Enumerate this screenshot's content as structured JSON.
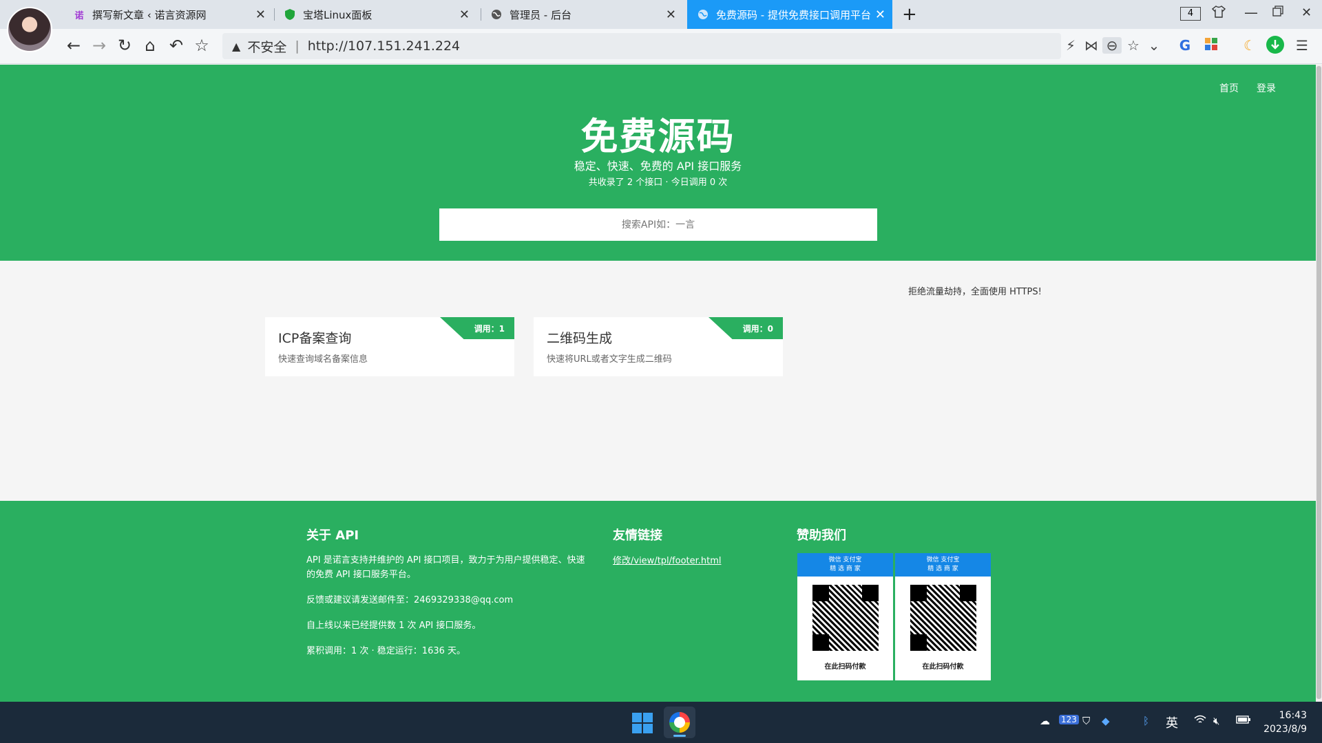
{
  "browser": {
    "tabs": [
      {
        "title": "撰写新文章 ‹ 诺言资源网",
        "icon": "诺",
        "active": false
      },
      {
        "title": "宝塔Linux面板",
        "icon": "shield-icon",
        "active": false
      },
      {
        "title": "管理员 - 后台",
        "icon": "globe-icon",
        "active": false
      },
      {
        "title": "免费源码 - 提供免费接口调用平台",
        "icon": "globe-icon",
        "active": true
      }
    ],
    "tab_count": "4",
    "address": {
      "insecure_label": "不安全",
      "separator": "|",
      "url": "http://107.151.241.224"
    }
  },
  "site": {
    "nav": {
      "home": "首页",
      "login": "登录"
    },
    "title": "免费源码",
    "subtitle": "稳定、快速、免费的 API 接口服务",
    "stats": "共收录了 2 个接口 · 今日调用 0 次",
    "search_placeholder": "搜索API如：一言",
    "notice": "拒绝流量劫持，全面使用 HTTPS!",
    "cards": [
      {
        "title": "ICP备案查询",
        "desc": "快速查询域名备案信息",
        "calls": "调用：1"
      },
      {
        "title": "二维码生成",
        "desc": "快速将URL或者文字生成二维码",
        "calls": "调用：0"
      }
    ]
  },
  "footer": {
    "about_title": "关于 API",
    "about_text": "API 是诺言支持并维护的 API 接口项目，致力于为用户提供稳定、快速的免费 API 接口服务平台。",
    "feedback": "反馈或建议请发送邮件至：2469329338@qq.com",
    "served": "自上线以来已经提供数 1 次 API 接口服务。",
    "totals": "累积调用：1 次 · 稳定运行：1636 天。",
    "links_title": "友情链接",
    "link_text": "修改/view/tpl/footer.html",
    "sponsor_title": "赞助我们",
    "qr": [
      {
        "top": "微信  支付宝",
        "sub": "精 选 商 家",
        "caption": "在此扫码付款"
      },
      {
        "top": "微信  支付宝",
        "sub": "精 选 商 家",
        "caption": "在此扫码付款"
      }
    ]
  },
  "taskbar": {
    "ime": "英",
    "time": "16:43",
    "date": "2023/8/9"
  },
  "colors": {
    "brand_green": "#2aaf60",
    "active_tab": "#1b9af7"
  }
}
